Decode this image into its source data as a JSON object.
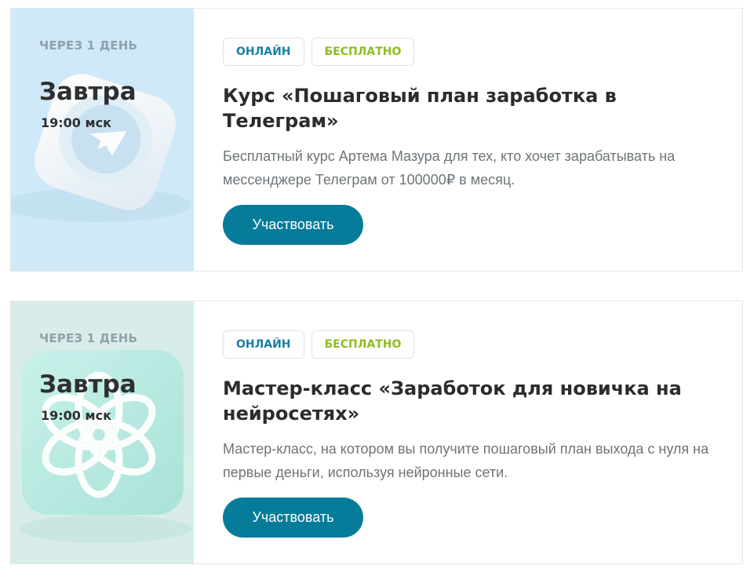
{
  "events": [
    {
      "when": "ЧЕРЕЗ 1 ДЕНЬ",
      "day": "Завтра",
      "time": "19:00 мск",
      "tags": [
        "ОНЛАЙН",
        "БЕСПЛАТНО"
      ],
      "title": "Курс «Пошаговый план заработка в Телеграм»",
      "description": "Бесплатный курс Артема Мазура для тех, кто хочет зарабатывать на мессенджере Телеграм от 100000₽ в месяц.",
      "button_label": "Участвовать",
      "icon": "telegram-icon",
      "thumb_color": "#cfe9f8"
    },
    {
      "when": "ЧЕРЕЗ 1 ДЕНЬ",
      "day": "Завтра",
      "time": "19:00 мск",
      "tags": [
        "ОНЛАЙН",
        "БЕСПЛАТНО"
      ],
      "title": "Мастер-класс «Заработок для новичка на нейросетях»",
      "description": "Мастер-класс, на котором вы получите пошаговый план выхода с нуля на первые деньги, используя нейронные сети.",
      "button_label": "Участвовать",
      "icon": "openai-icon",
      "thumb_color": "#d8ede9"
    }
  ],
  "colors": {
    "accent": "#077c9a",
    "online_tag": "#1c7fa3",
    "free_tag": "#8ebc1e"
  }
}
